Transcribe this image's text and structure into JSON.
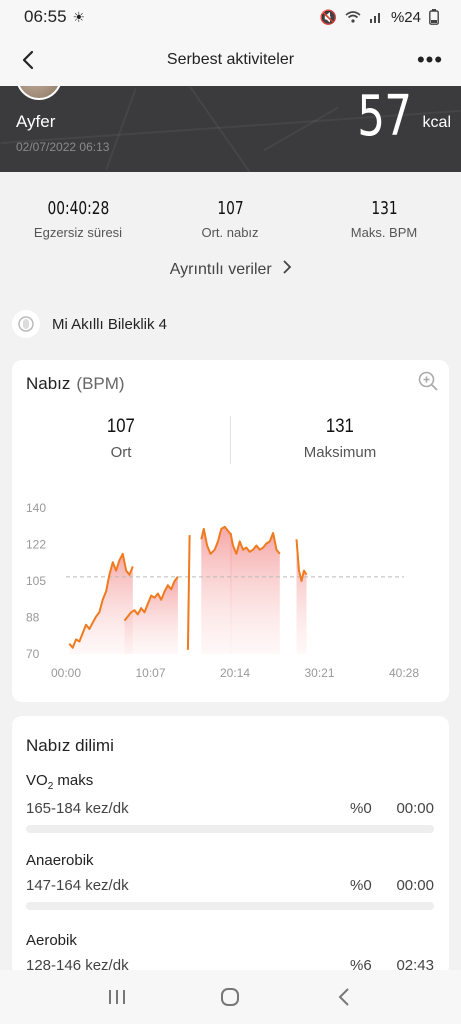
{
  "status_bar": {
    "time": "06:55",
    "battery": "%24"
  },
  "header": {
    "title": "Serbest aktiviteler"
  },
  "profile": {
    "name": "Ayfer",
    "date": "02/07/2022 06:13",
    "kcal_value": "57",
    "kcal_unit": "kcal"
  },
  "summary": {
    "stats": [
      {
        "value": "00:40:28",
        "label": "Egzersiz süresi"
      },
      {
        "value": "107",
        "label": "Ort. nabız"
      },
      {
        "value": "131",
        "label": "Maks. BPM"
      }
    ],
    "details_link": "Ayrıntılı veriler"
  },
  "device": {
    "name": "Mi Akıllı Bileklik 4"
  },
  "heart_rate": {
    "title": "Nabız",
    "unit": "(BPM)",
    "avg_value": "107",
    "avg_label": "Ort",
    "max_value": "131",
    "max_label": "Maksimum"
  },
  "chart_data": {
    "type": "area",
    "title": "Nabız (BPM)",
    "xlabel": "",
    "ylabel": "",
    "y_ticks": [
      "140",
      "122",
      "105",
      "88",
      "70"
    ],
    "x_ticks": [
      "00:00",
      "10:07",
      "20:14",
      "30:21",
      "40:28"
    ],
    "ylim": [
      70,
      140
    ],
    "xlim": [
      0,
      40.47
    ],
    "reference_line": 107,
    "series": [
      {
        "values": [
          [
            0.4,
            75
          ],
          [
            0.8,
            73
          ],
          [
            1.2,
            77
          ],
          [
            1.6,
            76
          ],
          [
            2.0,
            80
          ],
          [
            2.4,
            84
          ],
          [
            2.8,
            82
          ],
          [
            3.2,
            85
          ],
          [
            3.6,
            88
          ],
          [
            4.0,
            90
          ],
          [
            4.4,
            96
          ],
          [
            4.8,
            100
          ],
          [
            5.2,
            108
          ],
          [
            5.6,
            114
          ],
          [
            6.0,
            110
          ],
          [
            6.4,
            115
          ],
          [
            6.8,
            118
          ],
          [
            7.2,
            110
          ],
          [
            7.6,
            108
          ],
          [
            8.0,
            112
          ]
        ]
      },
      {
        "values": [
          [
            7.0,
            86
          ],
          [
            7.4,
            88
          ],
          [
            7.8,
            90
          ],
          [
            8.2,
            91
          ],
          [
            8.6,
            89
          ],
          [
            9.0,
            92
          ],
          [
            9.4,
            90
          ],
          [
            9.8,
            94
          ],
          [
            10.2,
            98
          ],
          [
            10.6,
            97
          ],
          [
            11.0,
            99
          ],
          [
            11.4,
            96
          ],
          [
            11.8,
            100
          ],
          [
            12.2,
            103
          ],
          [
            12.6,
            101
          ],
          [
            13.0,
            105
          ],
          [
            13.4,
            107
          ]
        ]
      },
      {
        "values": [
          [
            14.6,
            72
          ],
          [
            14.8,
            127
          ]
        ]
      },
      {
        "values": [
          [
            16.2,
            125
          ],
          [
            16.5,
            130
          ],
          [
            16.9,
            122
          ],
          [
            17.3,
            118
          ],
          [
            17.8,
            120
          ],
          [
            18.2,
            124
          ],
          [
            18.6,
            130
          ],
          [
            19.0,
            131
          ],
          [
            19.4,
            129
          ],
          [
            19.8,
            127
          ]
        ]
      },
      {
        "values": [
          [
            19.7,
            128
          ],
          [
            20.0,
            122
          ],
          [
            20.4,
            118
          ],
          [
            20.8,
            124
          ],
          [
            21.2,
            120
          ],
          [
            21.6,
            121
          ],
          [
            22.0,
            119
          ],
          [
            22.4,
            120
          ],
          [
            22.8,
            122
          ],
          [
            23.2,
            120
          ],
          [
            23.6,
            121
          ],
          [
            24.0,
            123
          ],
          [
            24.4,
            124
          ],
          [
            24.8,
            128
          ],
          [
            25.2,
            120
          ],
          [
            25.6,
            118
          ]
        ]
      },
      {
        "values": [
          [
            27.6,
            125
          ],
          [
            27.9,
            110
          ],
          [
            28.2,
            105
          ],
          [
            28.5,
            110
          ],
          [
            28.8,
            108
          ]
        ]
      }
    ]
  },
  "zones": {
    "title": "Nabız dilimi",
    "items": [
      {
        "name": "VO₂ maks",
        "range": "165-184 kez/dk",
        "percent": "%0",
        "duration": "00:00",
        "fill": 0
      },
      {
        "name": "Anaerobik",
        "range": "147-164 kez/dk",
        "percent": "%0",
        "duration": "00:00",
        "fill": 0
      },
      {
        "name": "Aerobik",
        "range": "128-146 kez/dk",
        "percent": "%6",
        "duration": "02:43",
        "fill": 0.06
      }
    ]
  },
  "icons": {
    "back": "back-arrow-icon",
    "more": "more-icon",
    "zoom": "zoom-in-icon",
    "recents": "recents-icon",
    "home": "home-icon",
    "nav_back": "nav-back-icon"
  },
  "colors": {
    "accent": "#f07a1e",
    "area_fill": "#f5a6a6",
    "hero_bg": "#3b3b3d"
  }
}
